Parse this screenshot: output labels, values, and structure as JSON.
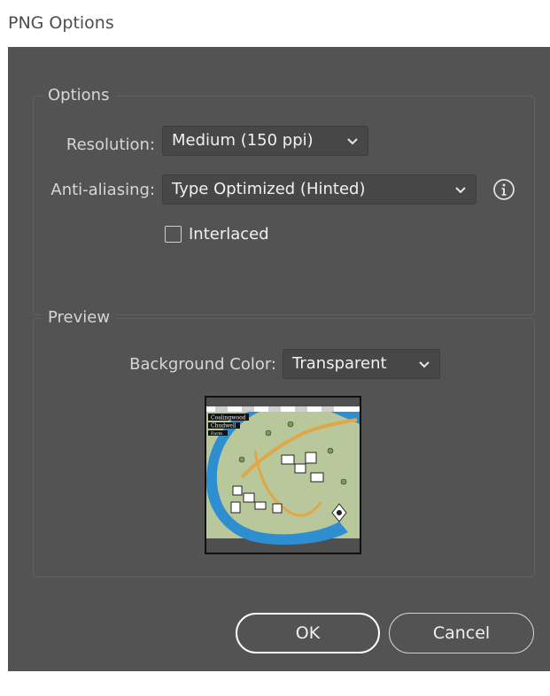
{
  "window": {
    "title": "PNG Options"
  },
  "options": {
    "group_label": "Options",
    "resolution_label": "Resolution:",
    "resolution_value": "Medium (150 ppi)",
    "antialiasing_label": "Anti-aliasing:",
    "antialiasing_value": "Type Optimized (Hinted)",
    "interlaced_label": "Interlaced",
    "interlaced_checked": false
  },
  "preview": {
    "group_label": "Preview",
    "background_label": "Background Color:",
    "background_value": "Transparent",
    "map_labels": [
      "Coalingwood",
      "Chudwell",
      "Farm"
    ]
  },
  "buttons": {
    "ok_label": "OK",
    "cancel_label": "Cancel"
  },
  "colors": {
    "dialog_bg": "#535353",
    "river": "#2e8fd0",
    "land": "#b9c89a",
    "path": "#e0a64a"
  }
}
